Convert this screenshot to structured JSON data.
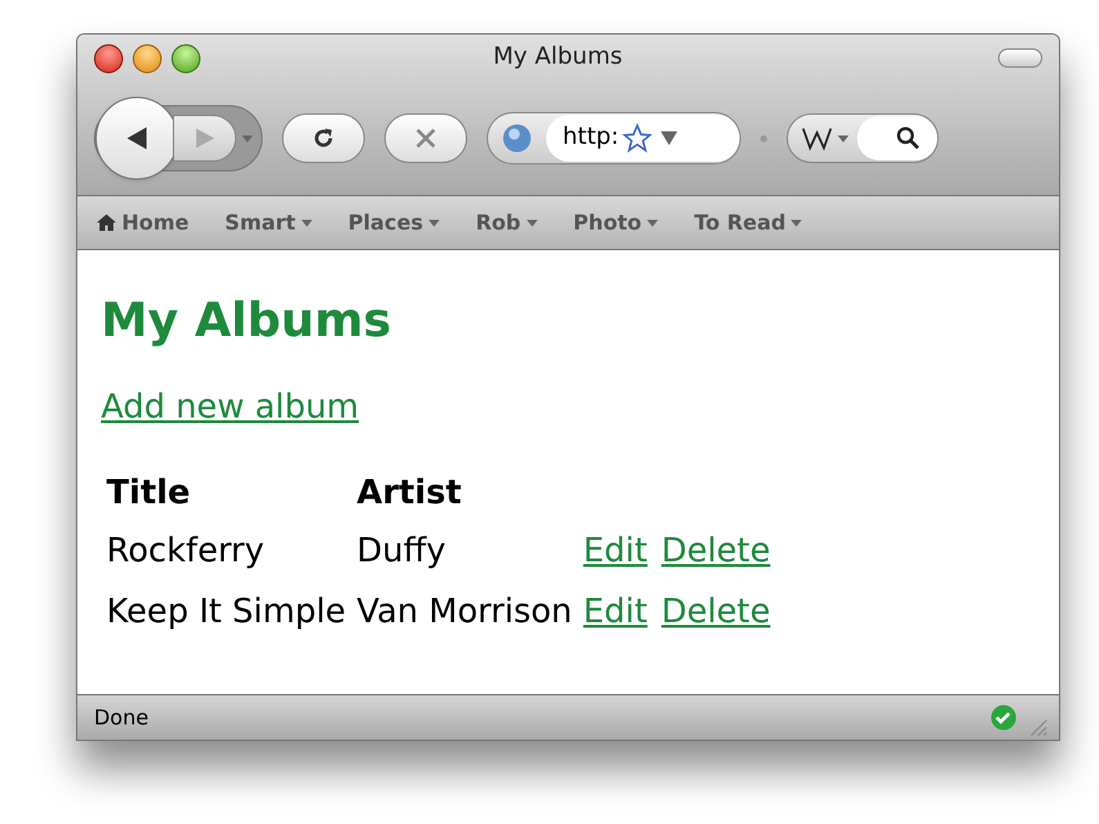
{
  "window": {
    "title": "My Albums"
  },
  "toolbar": {
    "back": {
      "disabled": false
    },
    "forward": {
      "disabled": true
    },
    "address": {
      "value": "http:"
    }
  },
  "bookmarks": [
    {
      "label": "Home",
      "kind": "home"
    },
    {
      "label": "Smart",
      "kind": "folder"
    },
    {
      "label": "Places",
      "kind": "folder"
    },
    {
      "label": "Rob",
      "kind": "folder"
    },
    {
      "label": "Photo",
      "kind": "folder"
    },
    {
      "label": "To Read",
      "kind": "folder"
    }
  ],
  "page": {
    "heading": "My Albums",
    "add_link": "Add new album",
    "table": {
      "columns": [
        "Title",
        "Artist"
      ],
      "rows": [
        {
          "title": "Rockferry",
          "artist": "Duffy",
          "actions": [
            "Edit",
            "Delete"
          ]
        },
        {
          "title": "Keep It Simple",
          "artist": "Van Morrison",
          "actions": [
            "Edit",
            "Delete"
          ]
        }
      ]
    }
  },
  "status_bar": {
    "text": "Done"
  }
}
